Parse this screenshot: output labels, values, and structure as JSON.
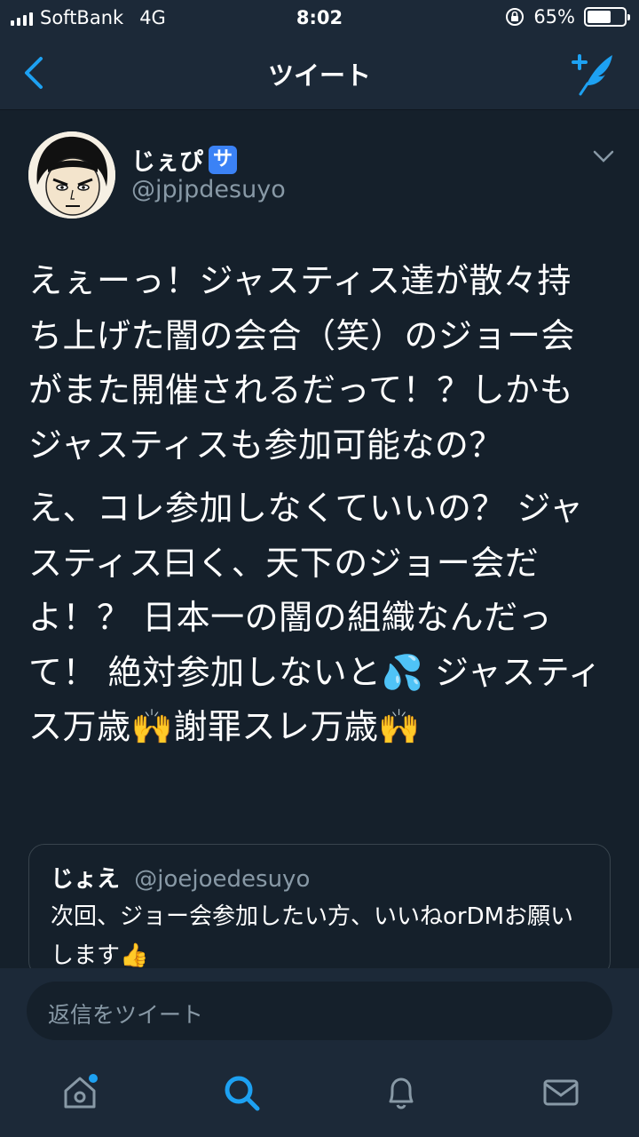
{
  "status_bar": {
    "carrier": "SoftBank",
    "network": "4G",
    "time": "8:02",
    "battery_percent": "65%",
    "battery_level": 0.65,
    "orientation_lock_icon": "orientation-lock-icon"
  },
  "nav": {
    "title": "ツイート",
    "back_icon": "chevron-left-icon",
    "compose_icon": "compose-tweet-icon"
  },
  "tweet": {
    "display_name": "じぇぴ",
    "badge": "サ",
    "handle": "@jpjpdesuyo",
    "paragraphs": [
      "えぇーっ！ジャスティス達が散々持ち上げた闇の会合（笑）のジョー会がまた開催されるだって！？しかもジャスティスも参加可能なの？",
      "え、コレ参加しなくていいの？ ジャスティス曰く、天下のジョー会だよ！？ 日本一の闇の組織なんだって！ 絶対参加しないと💦 ジャスティス万歳🙌謝罪スレ万歳🙌"
    ]
  },
  "quote": {
    "display_name": "じょえ",
    "handle": "@joejoedesuyo",
    "text": "次回、ジョー会参加したい方、いいねorDMお願いします👍"
  },
  "reply": {
    "placeholder": "返信をツイート"
  },
  "tabs": [
    {
      "name": "home",
      "icon": "home-icon",
      "active": false,
      "notification_dot": true
    },
    {
      "name": "search",
      "icon": "search-icon",
      "active": true
    },
    {
      "name": "notifications",
      "icon": "bell-icon",
      "active": false
    },
    {
      "name": "messages",
      "icon": "mail-icon",
      "active": false
    }
  ],
  "colors": {
    "background": "#15202b",
    "bar": "#1c2938",
    "accent": "#1da1f2",
    "secondary_text": "#8899a6",
    "badge": "#3b82f6"
  }
}
